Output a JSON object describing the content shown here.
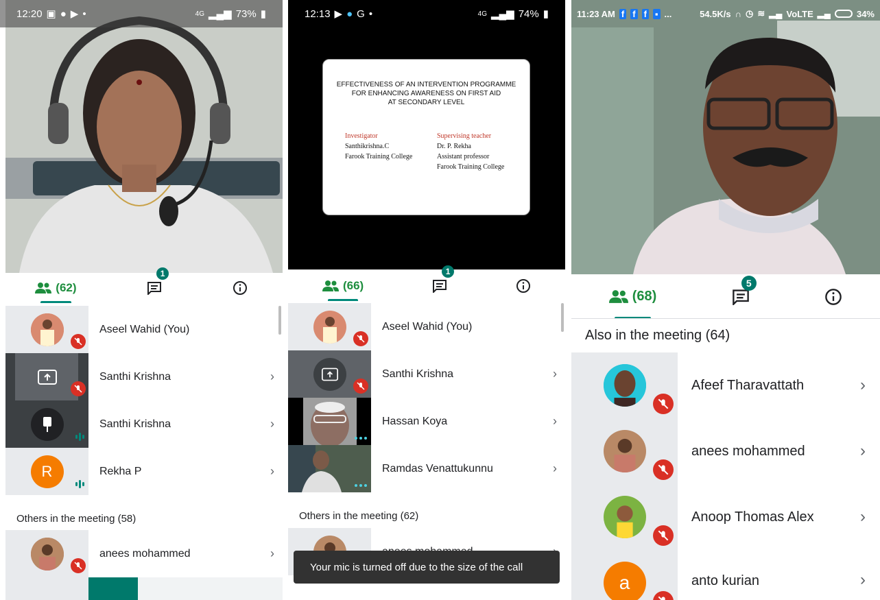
{
  "panel1": {
    "status": {
      "time": "12:20",
      "signal": "4G",
      "battery": "73%"
    },
    "tabs": {
      "people": "(62)",
      "chat_badge": "1"
    },
    "participants": [
      {
        "name": "Aseel Wahid (You)"
      },
      {
        "name": "Santhi Krishna"
      },
      {
        "name": "Santhi Krishna"
      },
      {
        "name": "Rekha P",
        "initial": "R"
      }
    ],
    "others_header": "Others in the meeting (58)",
    "others": [
      {
        "name": "anees mohammed"
      }
    ]
  },
  "panel2": {
    "status": {
      "time": "12:13",
      "signal": "4G",
      "battery": "74%"
    },
    "tabs": {
      "people": "(66)",
      "chat_badge": "1"
    },
    "slide": {
      "title_line1": "EFFECTIVENESS OF AN INTERVENTION PROGRAMME",
      "title_line2": "FOR ENHANCING AWARENESS ON FIRST AID",
      "title_line3": "AT SECONDARY LEVEL",
      "investigator_label": "Investigator",
      "investigator_name": "Santhikrishna.C",
      "investigator_college": "Farook Training College",
      "supervisor_label": "Supervising teacher",
      "supervisor_name": "Dr. P. Rekha",
      "supervisor_role": "Assistant professor",
      "supervisor_college": "Farook Training College"
    },
    "participants": [
      {
        "name": "Aseel Wahid (You)"
      },
      {
        "name": "Santhi Krishna"
      },
      {
        "name": "Hassan Koya"
      },
      {
        "name": "Ramdas Venattukunnu"
      }
    ],
    "others_header": "Others in the meeting (62)",
    "others": [
      {
        "name": "anees mohammed"
      }
    ],
    "toast": "Your mic is turned off due to the size of the call"
  },
  "panel3": {
    "status": {
      "time": "11:23 AM",
      "ellipsis": "...",
      "speed": "54.5K/s",
      "network": "VoLTE",
      "battery": "34%"
    },
    "tabs": {
      "people": "(68)",
      "chat_badge": "5"
    },
    "also_header": "Also in the meeting (64)",
    "participants": [
      {
        "name": "Afeef Tharavattath"
      },
      {
        "name": "anees mohammed"
      },
      {
        "name": "Anoop Thomas Alex"
      },
      {
        "name": "anto kurian",
        "initial": "a"
      }
    ]
  },
  "colors": {
    "accent": "#1e8e3e",
    "mute": "#d93025",
    "orange": "#f57c00",
    "teal": "#00897b"
  },
  "icons": [
    "people-icon",
    "chat-icon",
    "info-icon",
    "mic-off-icon",
    "chevron-right-icon",
    "present-icon",
    "pin-icon"
  ]
}
